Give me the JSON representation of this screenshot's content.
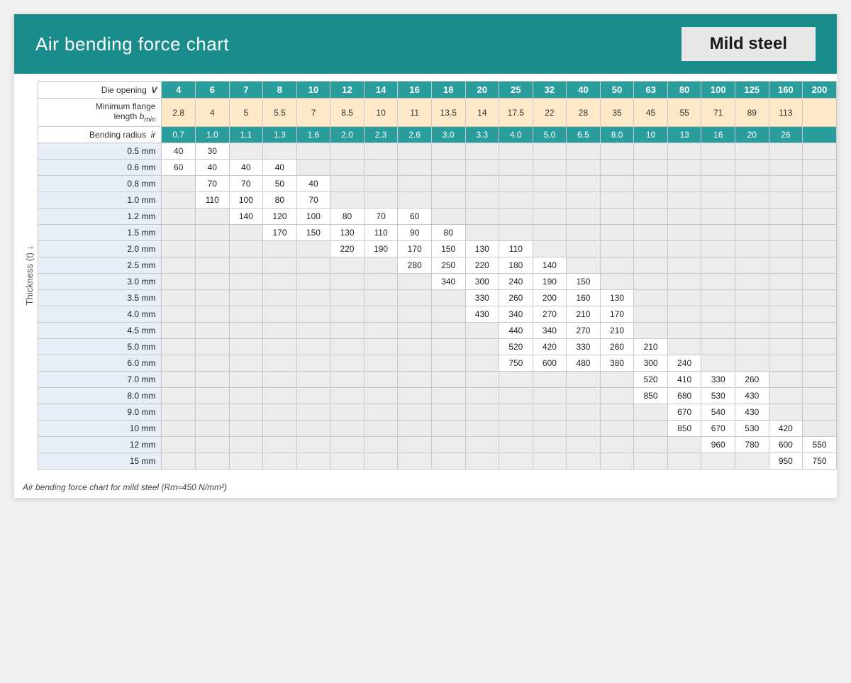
{
  "header": {
    "title": "Air bending force chart",
    "subtitle": "Mild steel"
  },
  "table": {
    "die_opening_label": "Die opening",
    "die_opening_V": "V",
    "min_flange_label": "Minimum flange length",
    "min_flange_b": "b",
    "min_flange_sub": "min",
    "bending_radius_label": "Bending radius",
    "bending_radius_ir": "ir",
    "thickness_label": "Thickness (t) ↓",
    "columns": [
      "4",
      "6",
      "7",
      "8",
      "10",
      "12",
      "14",
      "16",
      "18",
      "20",
      "25",
      "32",
      "40",
      "50",
      "63",
      "80",
      "100",
      "125",
      "160",
      "200"
    ],
    "min_flange_values": [
      "2.8",
      "4",
      "5",
      "5.5",
      "7",
      "8.5",
      "10",
      "11",
      "13.5",
      "14",
      "17.5",
      "22",
      "28",
      "35",
      "45",
      "55",
      "71",
      "89",
      "113",
      ""
    ],
    "bending_radius_values": [
      "0.7",
      "1.0",
      "1.1",
      "1.3",
      "1.6",
      "2.0",
      "2.3",
      "2.6",
      "3.0",
      "3.3",
      "4.0",
      "5.0",
      "6.5",
      "8.0",
      "10",
      "13",
      "16",
      "20",
      "26",
      ""
    ],
    "rows": [
      {
        "label": "0.5 mm",
        "values": [
          "40",
          "30",
          "",
          "",
          "",
          "",
          "",
          "",
          "",
          "",
          "",
          "",
          "",
          "",
          "",
          "",
          "",
          "",
          "",
          ""
        ]
      },
      {
        "label": "0.6 mm",
        "values": [
          "60",
          "40",
          "40",
          "40",
          "",
          "",
          "",
          "",
          "",
          "",
          "",
          "",
          "",
          "",
          "",
          "",
          "",
          "",
          "",
          ""
        ]
      },
      {
        "label": "0.8 mm",
        "values": [
          "",
          "70",
          "70",
          "50",
          "40",
          "",
          "",
          "",
          "",
          "",
          "",
          "",
          "",
          "",
          "",
          "",
          "",
          "",
          "",
          ""
        ]
      },
      {
        "label": "1.0 mm",
        "values": [
          "",
          "110",
          "100",
          "80",
          "70",
          "",
          "",
          "",
          "",
          "",
          "",
          "",
          "",
          "",
          "",
          "",
          "",
          "",
          "",
          ""
        ]
      },
      {
        "label": "1.2 mm",
        "values": [
          "",
          "",
          "140",
          "120",
          "100",
          "80",
          "70",
          "60",
          "",
          "",
          "",
          "",
          "",
          "",
          "",
          "",
          "",
          "",
          "",
          ""
        ]
      },
      {
        "label": "1.5 mm",
        "values": [
          "",
          "",
          "",
          "170",
          "150",
          "130",
          "110",
          "90",
          "80",
          "",
          "",
          "",
          "",
          "",
          "",
          "",
          "",
          "",
          "",
          ""
        ]
      },
      {
        "label": "2.0 mm",
        "values": [
          "",
          "",
          "",
          "",
          "",
          "220",
          "190",
          "170",
          "150",
          "130",
          "110",
          "",
          "",
          "",
          "",
          "",
          "",
          "",
          "",
          ""
        ]
      },
      {
        "label": "2.5 mm",
        "values": [
          "",
          "",
          "",
          "",
          "",
          "",
          "",
          "280",
          "250",
          "220",
          "180",
          "140",
          "",
          "",
          "",
          "",
          "",
          "",
          "",
          ""
        ]
      },
      {
        "label": "3.0 mm",
        "values": [
          "",
          "",
          "",
          "",
          "",
          "",
          "",
          "",
          "340",
          "300",
          "240",
          "190",
          "150",
          "",
          "",
          "",
          "",
          "",
          "",
          ""
        ]
      },
      {
        "label": "3.5 mm",
        "values": [
          "",
          "",
          "",
          "",
          "",
          "",
          "",
          "",
          "",
          "330",
          "260",
          "200",
          "160",
          "130",
          "",
          "",
          "",
          "",
          "",
          ""
        ]
      },
      {
        "label": "4.0 mm",
        "values": [
          "",
          "",
          "",
          "",
          "",
          "",
          "",
          "",
          "",
          "430",
          "340",
          "270",
          "210",
          "170",
          "",
          "",
          "",
          "",
          "",
          ""
        ]
      },
      {
        "label": "4.5 mm",
        "values": [
          "",
          "",
          "",
          "",
          "",
          "",
          "",
          "",
          "",
          "",
          "440",
          "340",
          "270",
          "210",
          "",
          "",
          "",
          "",
          "",
          ""
        ]
      },
      {
        "label": "5.0 mm",
        "values": [
          "",
          "",
          "",
          "",
          "",
          "",
          "",
          "",
          "",
          "",
          "520",
          "420",
          "330",
          "260",
          "210",
          "",
          "",
          "",
          "",
          ""
        ]
      },
      {
        "label": "6.0 mm",
        "values": [
          "",
          "",
          "",
          "",
          "",
          "",
          "",
          "",
          "",
          "",
          "750",
          "600",
          "480",
          "380",
          "300",
          "240",
          "",
          "",
          "",
          ""
        ]
      },
      {
        "label": "7.0 mm",
        "values": [
          "",
          "",
          "",
          "",
          "",
          "",
          "",
          "",
          "",
          "",
          "",
          "",
          "",
          "",
          "520",
          "410",
          "330",
          "260",
          "",
          ""
        ]
      },
      {
        "label": "8.0 mm",
        "values": [
          "",
          "",
          "",
          "",
          "",
          "",
          "",
          "",
          "",
          "",
          "",
          "",
          "",
          "",
          "850",
          "680",
          "530",
          "430",
          "",
          ""
        ]
      },
      {
        "label": "9.0 mm",
        "values": [
          "",
          "",
          "",
          "",
          "",
          "",
          "",
          "",
          "",
          "",
          "",
          "",
          "",
          "",
          "",
          "670",
          "540",
          "430",
          "",
          ""
        ]
      },
      {
        "label": "10 mm",
        "values": [
          "",
          "",
          "",
          "",
          "",
          "",
          "",
          "",
          "",
          "",
          "",
          "",
          "",
          "",
          "",
          "850",
          "670",
          "530",
          "420",
          ""
        ]
      },
      {
        "label": "12 mm",
        "values": [
          "",
          "",
          "",
          "",
          "",
          "",
          "",
          "",
          "",
          "",
          "",
          "",
          "",
          "",
          "",
          "",
          "960",
          "780",
          "600",
          "550"
        ]
      },
      {
        "label": "15 mm",
        "values": [
          "",
          "",
          "",
          "",
          "",
          "",
          "",
          "",
          "",
          "",
          "",
          "",
          "",
          "",
          "",
          "",
          "",
          "",
          "950",
          "750"
        ]
      }
    ]
  },
  "footer": {
    "note": "Air bending force chart for mild steel (Rm≈450 N/mm²)"
  }
}
